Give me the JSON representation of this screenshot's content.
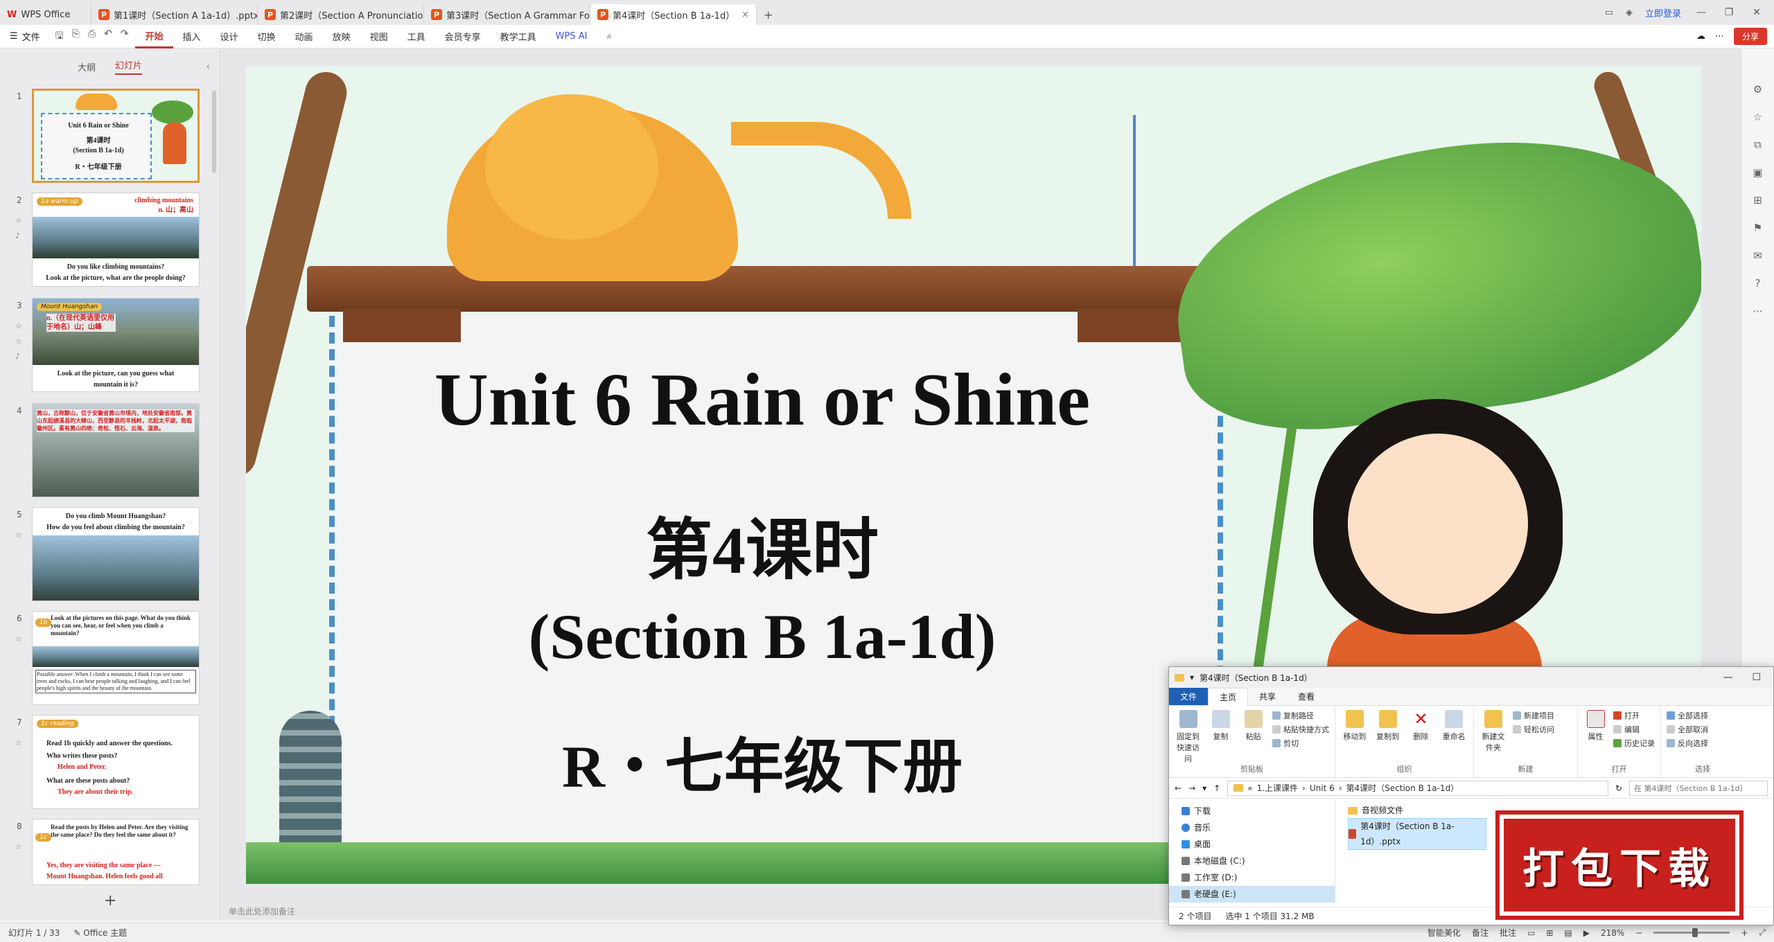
{
  "titlebar": {
    "home_tab": "WPS Office",
    "tabs": [
      {
        "label": "第1课时（Section A 1a-1d）.pptx",
        "active": false
      },
      {
        "label": "第2课时（Section A Pronunciation",
        "active": false
      },
      {
        "label": "第3课时（Section A Grammar Focu",
        "active": false
      },
      {
        "label": "第4课时（Section B 1a-1d）",
        "active": true
      }
    ],
    "ppt_badge": "P",
    "wps_badge": "W",
    "login": "立即登录",
    "add_tab": "+"
  },
  "menubar": {
    "file": "文件",
    "items": [
      "开始",
      "插入",
      "设计",
      "切换",
      "动画",
      "放映",
      "视图",
      "工具",
      "会员专享",
      "教学工具"
    ],
    "active": "开始",
    "ai": "WPS AI",
    "share": "分享"
  },
  "leftpanel": {
    "tab_outline": "大纲",
    "tab_slides": "幻灯片",
    "thumbnails": [
      {
        "num": "1",
        "line1": "Unit 6 Rain or Shine",
        "line2": "第4课时",
        "line3": "(Section B 1a-1d)",
        "line4": "R・七年级下册"
      },
      {
        "num": "2",
        "hdr": "1a warm up",
        "red1": "climbing mountains",
        "red2": "n. 山；高山",
        "q1": "Do you like climbing mountains?",
        "q2": "Look at the picture, what are the people doing?"
      },
      {
        "num": "3",
        "hdr": "Mount Huangshan",
        "red1": "n.（在现代英语里仅用于地名）山；山峰",
        "q1": "Look at the picture, can you guess what",
        "q2": "mountain it is?"
      },
      {
        "num": "4",
        "text": "黄山，古称黟山，位于安徽省黄山市境内，地处安徽省南部。黄山东起绩溪县的大嶂山，西至黟县的羊栈岭，北起太平湖，南临徽州区。素有黄山四绝：奇松、怪石、云海、温泉。"
      },
      {
        "num": "5",
        "q1": "Do you climb Mount Huangshan?",
        "q2": "How do you feel about climbing the mountain?"
      },
      {
        "num": "6",
        "hdr": "1b",
        "q1": "Look at the pictures on this page. What do you think you can see, hear, or feel when you climb a mountain?",
        "q2": "Possible answer: When I climb a mountain, I think I can see some trees and rocks, I can hear people talking and laughing, and I can feel people's high spirits and the beauty of the mountain."
      },
      {
        "num": "7",
        "hdr": "1c reading",
        "q1": "Read 1b quickly and answer the questions.",
        "q2": "Who writes these posts?",
        "red1": "Helen and Peter.",
        "q3": "What are these posts about?",
        "red2": "They are about their trip."
      },
      {
        "num": "8",
        "hdr": "1c",
        "q1": "Read the posts by Helen and Peter. Are they visiting the same place? Do they feel the same about it?",
        "red1": "Yes, they are visiting the same place —",
        "red2": "Mount Huangshan. Helen feels good all"
      }
    ],
    "add_slide": "+"
  },
  "slide": {
    "title": "Unit 6 Rain or Shine",
    "lesson": "第4课时",
    "section": "(Section B 1a-1d)",
    "grade": "R・七年级下册"
  },
  "notes": {
    "placeholder": "单击此处添加备注"
  },
  "statusbar": {
    "slide_counter": "幻灯片 1 / 33",
    "theme": "Office 主题",
    "smart": "智能美化",
    "notes": "备注",
    "comment": "批注",
    "zoom": "218%",
    "zoom_fraction": 0.55
  },
  "explorer": {
    "title": "第4课时（Section B 1a-1d）",
    "ribbon_tabs": [
      "文件",
      "主页",
      "共享",
      "查看"
    ],
    "groups": [
      {
        "name": "剪贴板",
        "buttons": [
          "固定到快速访问",
          "复制",
          "粘贴"
        ],
        "list": [
          "复制路径",
          "粘贴快捷方式",
          "剪切"
        ]
      },
      {
        "name": "组织",
        "buttons": [
          "移动到",
          "复制到",
          "删除",
          "重命名"
        ],
        "list": []
      },
      {
        "name": "新建",
        "buttons": [
          "新建文件夹"
        ],
        "list": [
          "新建项目",
          "轻松访问"
        ]
      },
      {
        "name": "打开",
        "buttons": [
          "属性"
        ],
        "list": [
          "打开",
          "编辑",
          "历史记录"
        ]
      },
      {
        "name": "选择",
        "buttons": [],
        "list": [
          "全部选择",
          "全部取消",
          "反向选择"
        ]
      }
    ],
    "address": [
      "1.上课课件",
      "Unit 6",
      "第4课时（Section B 1a-1d）"
    ],
    "search_placeholder": "在 第4课时（Section B 1a-1d）",
    "nav": [
      "下载",
      "音乐",
      "桌面",
      "本地磁盘 (C:)",
      "工作室 (D:)",
      "老硬盘 (E:)"
    ],
    "nav_selected": "老硬盘 (E:)",
    "files": [
      "音视频文件",
      "第4课时（Section B 1a-1d）.pptx"
    ],
    "status_items": "2 个项目",
    "status_selected": "选中 1 个项目  31.2 MB"
  },
  "stamp": {
    "text": "打包下载"
  },
  "colors": {
    "accent": "#c0392b",
    "stamp": "#c8201d",
    "selected_thumb": "#e0963a"
  }
}
